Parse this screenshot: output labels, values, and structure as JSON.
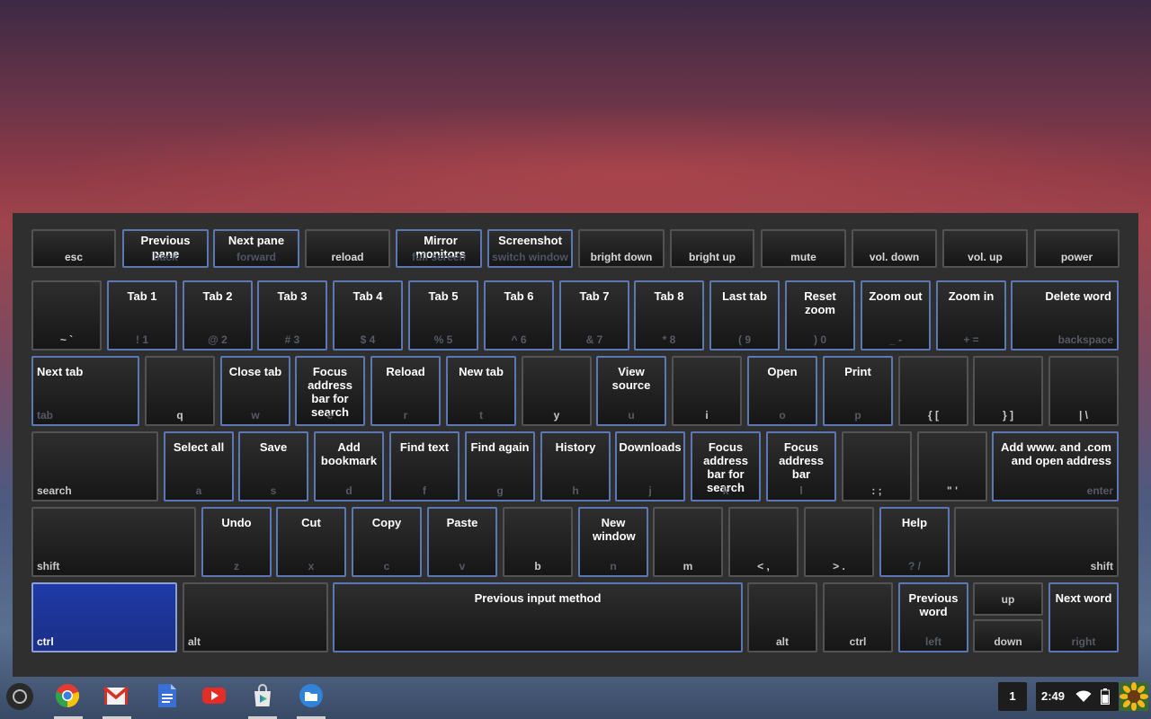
{
  "keyboard_overlay": {
    "row_function": [
      {
        "shortcut": "",
        "key": "esc"
      },
      {
        "shortcut": "Previous pane",
        "key": "back"
      },
      {
        "shortcut": "Next pane",
        "key": "forward"
      },
      {
        "shortcut": "",
        "key": "reload"
      },
      {
        "shortcut": "Mirror monitors",
        "key": "full screen"
      },
      {
        "shortcut": "Screenshot",
        "key": "switch window"
      },
      {
        "shortcut": "",
        "key": "bright down"
      },
      {
        "shortcut": "",
        "key": "bright up"
      },
      {
        "shortcut": "",
        "key": "mute"
      },
      {
        "shortcut": "",
        "key": "vol. down"
      },
      {
        "shortcut": "",
        "key": "vol. up"
      },
      {
        "shortcut": "",
        "key": "power"
      }
    ],
    "row_numbers": [
      {
        "shortcut": "",
        "key": "~ `"
      },
      {
        "shortcut": "Tab 1",
        "key": "! 1"
      },
      {
        "shortcut": "Tab 2",
        "key": "@ 2"
      },
      {
        "shortcut": "Tab 3",
        "key": "# 3"
      },
      {
        "shortcut": "Tab 4",
        "key": "$ 4"
      },
      {
        "shortcut": "Tab 5",
        "key": "% 5"
      },
      {
        "shortcut": "Tab 6",
        "key": "^ 6"
      },
      {
        "shortcut": "Tab 7",
        "key": "& 7"
      },
      {
        "shortcut": "Tab 8",
        "key": "* 8"
      },
      {
        "shortcut": "Last tab",
        "key": "( 9"
      },
      {
        "shortcut": "Reset zoom",
        "key": ") 0"
      },
      {
        "shortcut": "Zoom out",
        "key": "_ -"
      },
      {
        "shortcut": "Zoom in",
        "key": "+ ="
      },
      {
        "shortcut": "Delete word",
        "key": "backspace"
      }
    ],
    "row_qwerty": [
      {
        "shortcut": "Next tab",
        "key": "tab"
      },
      {
        "shortcut": "",
        "key": "q"
      },
      {
        "shortcut": "Close tab",
        "key": "w"
      },
      {
        "shortcut": "Focus address bar for search",
        "key": "e"
      },
      {
        "shortcut": "Reload",
        "key": "r"
      },
      {
        "shortcut": "New tab",
        "key": "t"
      },
      {
        "shortcut": "",
        "key": "y"
      },
      {
        "shortcut": "View source",
        "key": "u"
      },
      {
        "shortcut": "",
        "key": "i"
      },
      {
        "shortcut": "Open",
        "key": "o"
      },
      {
        "shortcut": "Print",
        "key": "p"
      },
      {
        "shortcut": "",
        "key": "{ ["
      },
      {
        "shortcut": "",
        "key": "} ]"
      },
      {
        "shortcut": "",
        "key": "| \\"
      }
    ],
    "row_home": [
      {
        "shortcut": "",
        "key": "search"
      },
      {
        "shortcut": "Select all",
        "key": "a"
      },
      {
        "shortcut": "Save",
        "key": "s"
      },
      {
        "shortcut": "Add bookmark",
        "key": "d"
      },
      {
        "shortcut": "Find text",
        "key": "f"
      },
      {
        "shortcut": "Find again",
        "key": "g"
      },
      {
        "shortcut": "History",
        "key": "h"
      },
      {
        "shortcut": "Downloads",
        "key": "j"
      },
      {
        "shortcut": "Focus address bar for search",
        "key": "k"
      },
      {
        "shortcut": "Focus address bar",
        "key": "l"
      },
      {
        "shortcut": "",
        "key": ": ;"
      },
      {
        "shortcut": "",
        "key": "\" '"
      },
      {
        "shortcut": "Add www. and .com and open address",
        "key": "enter"
      }
    ],
    "row_shift": [
      {
        "shortcut": "",
        "key": "shift"
      },
      {
        "shortcut": "Undo",
        "key": "z"
      },
      {
        "shortcut": "Cut",
        "key": "x"
      },
      {
        "shortcut": "Copy",
        "key": "c"
      },
      {
        "shortcut": "Paste",
        "key": "v"
      },
      {
        "shortcut": "",
        "key": "b"
      },
      {
        "shortcut": "New window",
        "key": "n"
      },
      {
        "shortcut": "",
        "key": "m"
      },
      {
        "shortcut": "",
        "key": "< ,"
      },
      {
        "shortcut": "",
        "key": "> ."
      },
      {
        "shortcut": "Help",
        "key": "? /"
      },
      {
        "shortcut": "",
        "key": "shift"
      }
    ],
    "row_bottom": [
      {
        "shortcut": "",
        "key": "ctrl"
      },
      {
        "shortcut": "",
        "key": "alt"
      },
      {
        "shortcut": "Previous input method",
        "key": ""
      },
      {
        "shortcut": "",
        "key": "alt"
      },
      {
        "shortcut": "",
        "key": "ctrl"
      },
      {
        "shortcut": "Previous word",
        "key": "left"
      },
      {
        "shortcut": "",
        "key": "up"
      },
      {
        "shortcut": "",
        "key": "down"
      },
      {
        "shortcut": "Next word",
        "key": "right"
      }
    ],
    "selected_modifier": "ctrl"
  },
  "shelf": {
    "apps": [
      {
        "name": "chrome-icon",
        "color": "#e33b2e"
      },
      {
        "name": "gmail-icon",
        "color": "#d93025"
      },
      {
        "name": "docs-icon",
        "color": "#3b6fd8"
      },
      {
        "name": "youtube-icon",
        "color": "#e52d27"
      },
      {
        "name": "play-store-icon",
        "color": "#3fb86b"
      },
      {
        "name": "files-icon",
        "color": "#2f83d8"
      }
    ],
    "status": {
      "notification_count": "1",
      "time": "2:49"
    }
  },
  "colors": {
    "overlay_bg": "#2f2f2f",
    "shortcut_border": "#5d77b3",
    "selected_key": "#1f3aa8"
  }
}
